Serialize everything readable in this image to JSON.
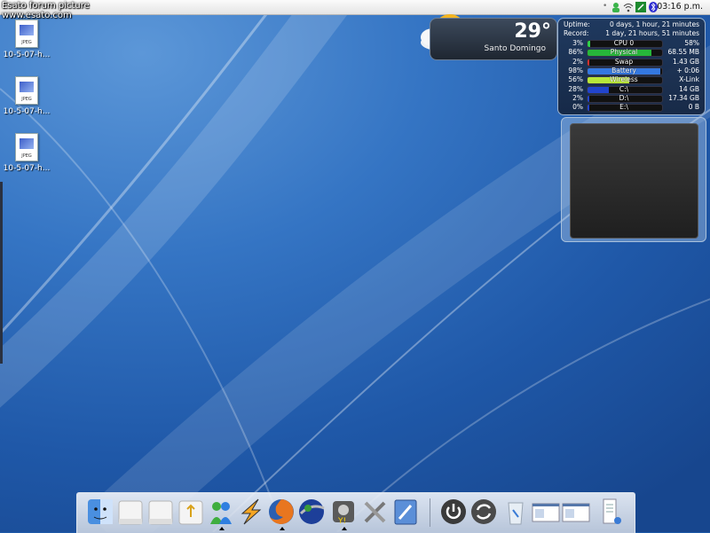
{
  "watermark": {
    "line1": "Esato forum picture",
    "line2": "www.esato.com"
  },
  "panel": {
    "clock": "03:16 p.m."
  },
  "desktop_icons": [
    {
      "label": "10-5-07-h...",
      "type": "JPEG"
    },
    {
      "label": "10-5-07-h...",
      "type": "JPEG"
    },
    {
      "label": "10-5-07-h...",
      "type": "JPEG"
    }
  ],
  "weather": {
    "temperature": "29°",
    "city": "Santo Domingo"
  },
  "system_monitor": {
    "uptime_label": "Uptime:",
    "uptime_value": "0 days, 1 hour, 21 minutes",
    "record_label": "Record:",
    "record_value": "1 day, 21 hours, 51 minutes",
    "meters": [
      {
        "percent": "3%",
        "fraction": 0.03,
        "name": "CPU 0",
        "value": "58%",
        "color": "#2fd04b"
      },
      {
        "percent": "86%",
        "fraction": 0.86,
        "name": "Physical",
        "value": "68.55 MB",
        "color": "#27b63a"
      },
      {
        "percent": "2%",
        "fraction": 0.02,
        "name": "Swap",
        "value": "1.43 GB",
        "color": "#d03030"
      },
      {
        "percent": "98%",
        "fraction": 0.98,
        "name": "Battery",
        "value": "+ 0:06",
        "color": "#3478e0"
      },
      {
        "percent": "56%",
        "fraction": 0.56,
        "name": "Wireless",
        "value": "X-Link",
        "color": "#b8e63a"
      },
      {
        "percent": "28%",
        "fraction": 0.28,
        "name": "C:\\",
        "value": "14 GB",
        "color": "#2244cc"
      },
      {
        "percent": "2%",
        "fraction": 0.02,
        "name": "D:\\",
        "value": "17.34 GB",
        "color": "#2244cc"
      },
      {
        "percent": "0%",
        "fraction": 0.0,
        "name": "E:\\",
        "value": "0 B",
        "color": "#2244cc"
      }
    ]
  },
  "dock": {
    "items": [
      "finder-icon",
      "drive-icon",
      "drive-icon",
      "usb-drive-icon",
      "messenger-icon",
      "winamp-icon",
      "firefox-icon",
      "google-earth-icon",
      "yahoo-messenger-icon",
      "utilities-icon",
      "system-preferences-icon",
      "power-icon",
      "sync-icon",
      "trash-icon",
      "window-thumbnail-icon",
      "window-thumbnail-icon",
      "document-icon"
    ]
  }
}
